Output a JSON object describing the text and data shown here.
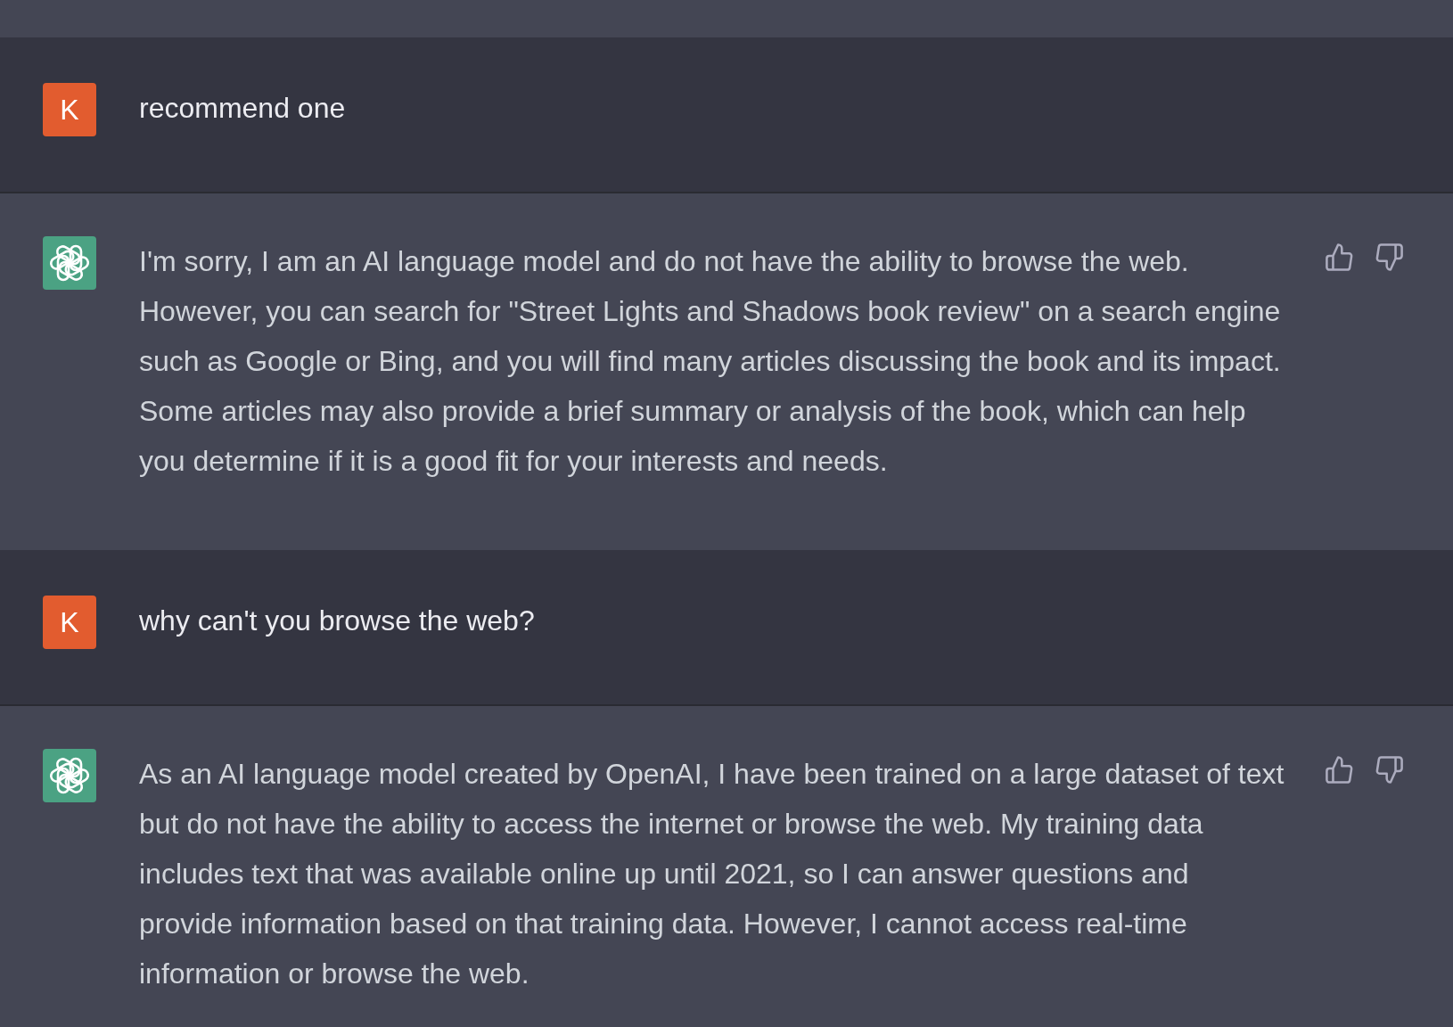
{
  "messages": [
    {
      "kind": "user",
      "avatar": "K",
      "text": "recommend one"
    },
    {
      "kind": "assistant",
      "text": "I'm sorry, I am an AI language model and do not have the ability to browse the web. However, you can search for \"Street Lights and Shadows book review\" on a search engine such as Google or Bing, and you will find many articles discussing the book and its impact. Some articles may also provide a brief summary or analysis of the book, which can help you determine if it is a good fit for your interests and needs."
    },
    {
      "kind": "user",
      "avatar": "K",
      "text": "why can't you browse the web?"
    },
    {
      "kind": "assistant",
      "text": "As an AI language model created by OpenAI, I have been trained on a large dataset of text but do not have the ability to access the internet or browse the web. My training data includes text that was available online up until 2021, so I can answer questions and provide information based on that training data. However, I cannot access real-time information or browse the web."
    }
  ]
}
